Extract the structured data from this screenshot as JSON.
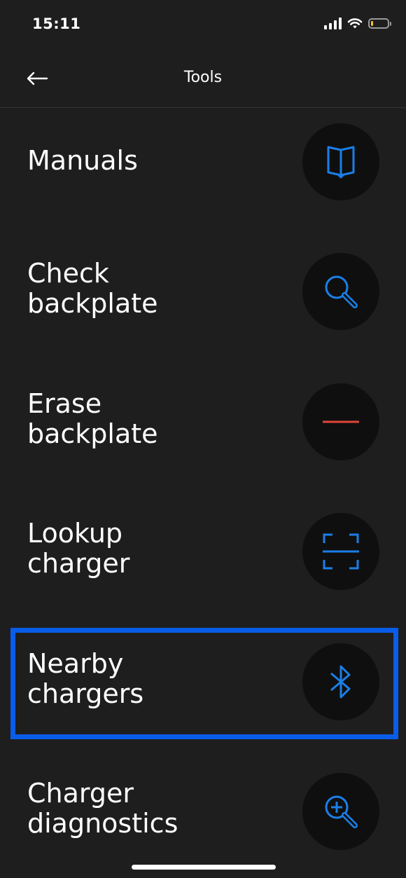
{
  "status_bar": {
    "time": "15:11",
    "battery_level": 0.15,
    "battery_color": "#f4c430"
  },
  "header": {
    "title": "Tools",
    "back_icon": "arrow-left-icon"
  },
  "colors": {
    "background": "#1e1e1e",
    "icon_circle": "#0f0f0f",
    "accent_blue": "#1a7fe8",
    "erase_red": "#e0443a",
    "highlight": "#0a5de8"
  },
  "tools": [
    {
      "label": "Manuals",
      "icon": "book-icon"
    },
    {
      "label": "Check\nbackplate",
      "icon": "search-icon"
    },
    {
      "label": "Erase\nbackplate",
      "icon": "minus-icon"
    },
    {
      "label": "Lookup\ncharger",
      "icon": "scan-icon"
    },
    {
      "label": "Nearby\nchargers",
      "icon": "bluetooth-icon"
    },
    {
      "label": "Charger\ndiagnostics",
      "icon": "zoom-in-icon"
    }
  ]
}
